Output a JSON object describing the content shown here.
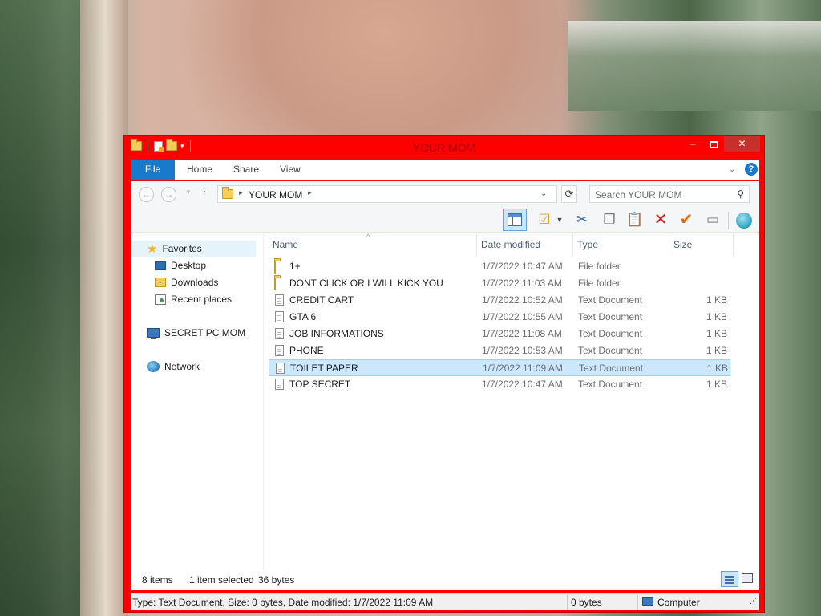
{
  "window": {
    "title": "YOUR MOM",
    "minimize": "‒",
    "close": "✕"
  },
  "ribbon": {
    "tabs": [
      "File",
      "Home",
      "Share",
      "View"
    ],
    "help": "?"
  },
  "address": {
    "path": "YOUR MOM",
    "search_placeholder": "Search YOUR MOM"
  },
  "nav_pane": {
    "favorites": "Favorites",
    "desktop": "Desktop",
    "downloads": "Downloads",
    "recent": "Recent places",
    "computer": "SECRET PC MOM",
    "network": "Network"
  },
  "columns": [
    "Name",
    "Date modified",
    "Type",
    "Size"
  ],
  "files": [
    {
      "name": "1+",
      "date": "1/7/2022 10:47 AM",
      "type": "File folder",
      "size": "",
      "icon": "folder-icon"
    },
    {
      "name": "DONT CLICK OR I WILL KICK YOU",
      "date": "1/7/2022 11:03 AM",
      "type": "File folder",
      "size": "",
      "icon": "folder-icon"
    },
    {
      "name": "CREDIT CART",
      "date": "1/7/2022 10:52 AM",
      "type": "Text Document",
      "size": "1 KB",
      "icon": "text-file-icon"
    },
    {
      "name": "GTA 6",
      "date": "1/7/2022 10:55 AM",
      "type": "Text Document",
      "size": "1 KB",
      "icon": "text-file-icon"
    },
    {
      "name": "JOB INFORMATIONS",
      "date": "1/7/2022 11:08 AM",
      "type": "Text Document",
      "size": "1 KB",
      "icon": "text-file-icon"
    },
    {
      "name": "PHONE",
      "date": "1/7/2022 10:53 AM",
      "type": "Text Document",
      "size": "1 KB",
      "icon": "text-file-icon"
    },
    {
      "name": "TOILET PAPER",
      "date": "1/7/2022 11:09 AM",
      "type": "Text Document",
      "size": "1 KB",
      "icon": "text-file-icon",
      "selected": true
    },
    {
      "name": "TOP SECRET",
      "date": "1/7/2022 10:47 AM",
      "type": "Text Document",
      "size": "1 KB",
      "icon": "text-file-icon"
    }
  ],
  "status": {
    "items": "8 items",
    "selected": "1 item selected",
    "bytes": "36 bytes"
  },
  "statusbar": {
    "info": "Type: Text Document, Size: 0 bytes, Date modified: 1/7/2022 11:09 AM",
    "bytes": "0 bytes",
    "computer": "Computer"
  },
  "colors": {
    "window_frame": "#ff0000",
    "title_text": "#a50000",
    "file_tab": "#1979ca",
    "selection": "#cce8ff"
  }
}
